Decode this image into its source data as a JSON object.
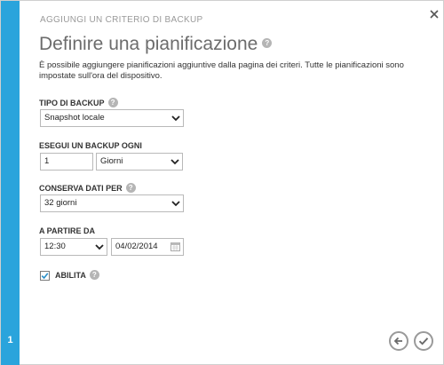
{
  "dialog": {
    "kicker": "AGGIUNGI UN CRITERIO DI BACKUP",
    "title": "Definire una pianificazione",
    "description": "È possibile aggiungere pianificazioni aggiuntive dalla pagina dei criteri. Tutte le pianificazioni sono impostate sull'ora del dispositivo.",
    "step": "1",
    "help_glyph": "?"
  },
  "form": {
    "backup_type": {
      "label": "TIPO DI BACKUP",
      "value": "Snapshot locale"
    },
    "run_every": {
      "label": "ESEGUI UN BACKUP OGNI",
      "count": "1",
      "unit": "Giorni"
    },
    "retain": {
      "label": "CONSERVA DATI PER",
      "value": "32 giorni"
    },
    "start": {
      "label": "A PARTIRE DA",
      "time": "12:30",
      "date": "04/02/2014"
    },
    "enable": {
      "label": "ABILITA",
      "checked": true
    }
  },
  "colors": {
    "accent": "#2aa4dc",
    "title": "#6c6c6c",
    "help": "#b5b5b5",
    "check": "#2a8fc8"
  }
}
